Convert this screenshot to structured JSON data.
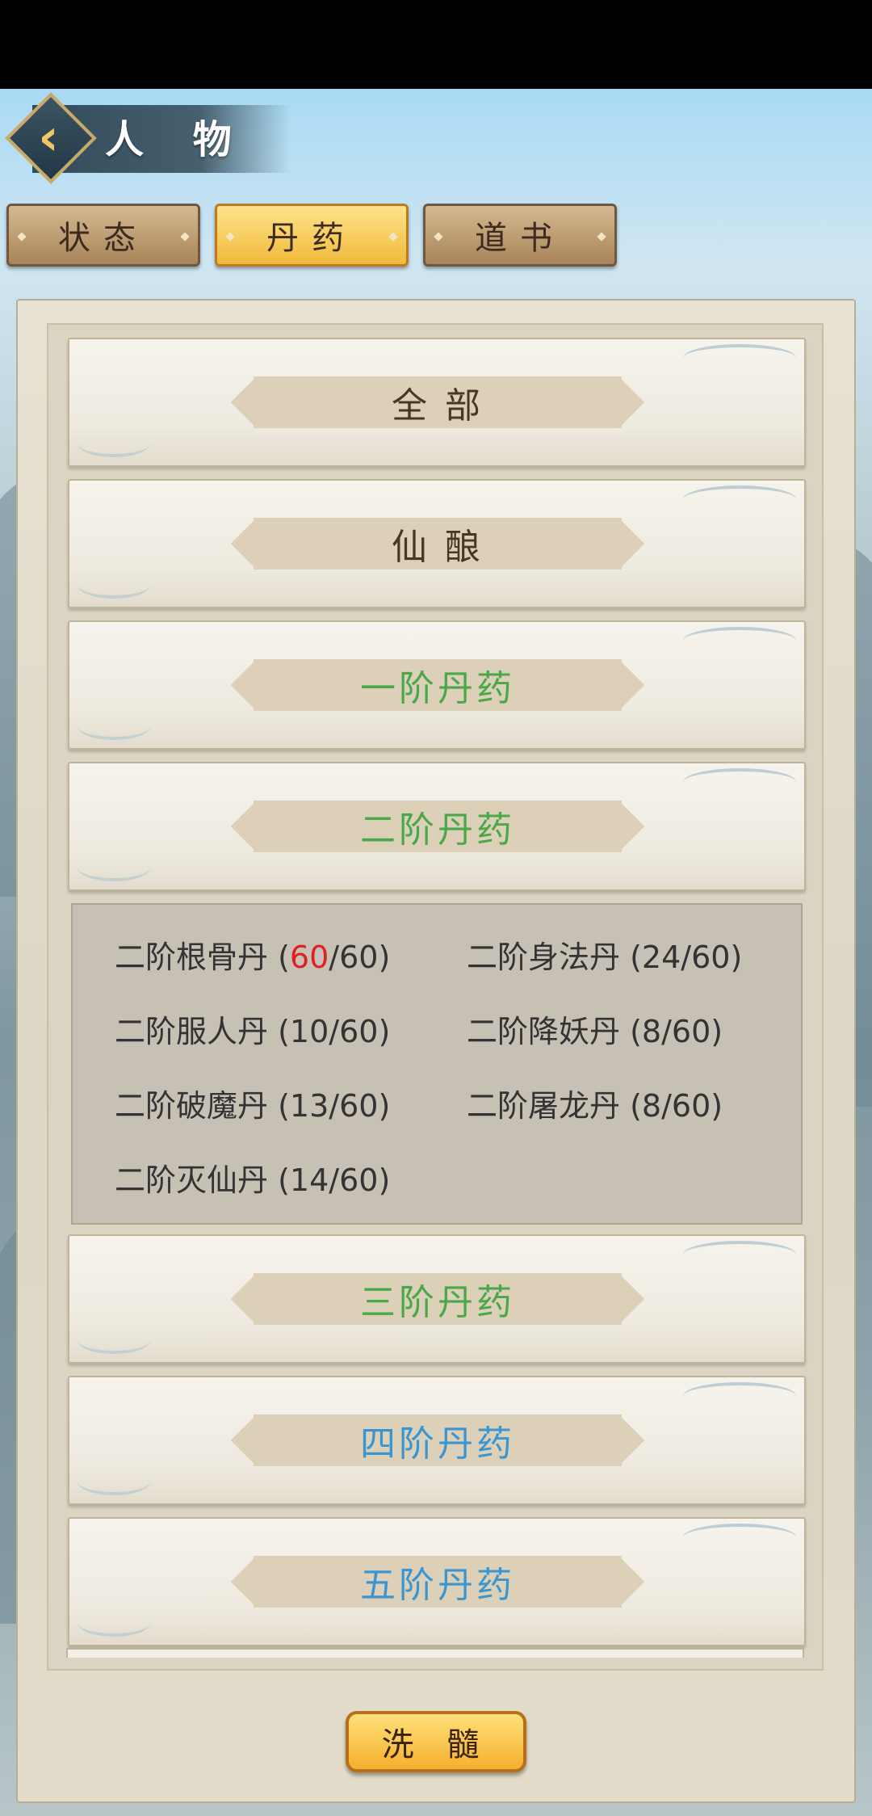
{
  "header": {
    "title": "人 物"
  },
  "tabs": [
    {
      "label": "状态",
      "active": false
    },
    {
      "label": "丹药",
      "active": true
    },
    {
      "label": "道书",
      "active": false
    }
  ],
  "categories": [
    {
      "label": "全 部",
      "color": "#4a3626"
    },
    {
      "label": "仙 酿",
      "color": "#4a3626"
    },
    {
      "label": "一阶丹药",
      "color": "#4aa84a"
    },
    {
      "label": "二阶丹药",
      "color": "#4aa84a"
    }
  ],
  "expanded_items": [
    {
      "name": "二阶根骨丹",
      "count": "60",
      "max": "60",
      "maxed": true
    },
    {
      "name": "二阶身法丹",
      "count": "24",
      "max": "60",
      "maxed": false
    },
    {
      "name": "二阶服人丹",
      "count": "10",
      "max": "60",
      "maxed": false
    },
    {
      "name": "二阶降妖丹",
      "count": "8",
      "max": "60",
      "maxed": false
    },
    {
      "name": "二阶破魔丹",
      "count": "13",
      "max": "60",
      "maxed": false
    },
    {
      "name": "二阶屠龙丹",
      "count": "8",
      "max": "60",
      "maxed": false
    },
    {
      "name": "二阶灭仙丹",
      "count": "14",
      "max": "60",
      "maxed": false
    }
  ],
  "categories_after": [
    {
      "label": "三阶丹药",
      "color": "#4aa84a"
    },
    {
      "label": "四阶丹药",
      "color": "#3a95d0"
    },
    {
      "label": "五阶丹药",
      "color": "#3a95d0"
    }
  ],
  "footer": {
    "button_label": "洗 髓"
  },
  "colors": {
    "highlight": "#e02020",
    "green_tier": "#4aa84a",
    "blue_tier": "#3a95d0"
  }
}
